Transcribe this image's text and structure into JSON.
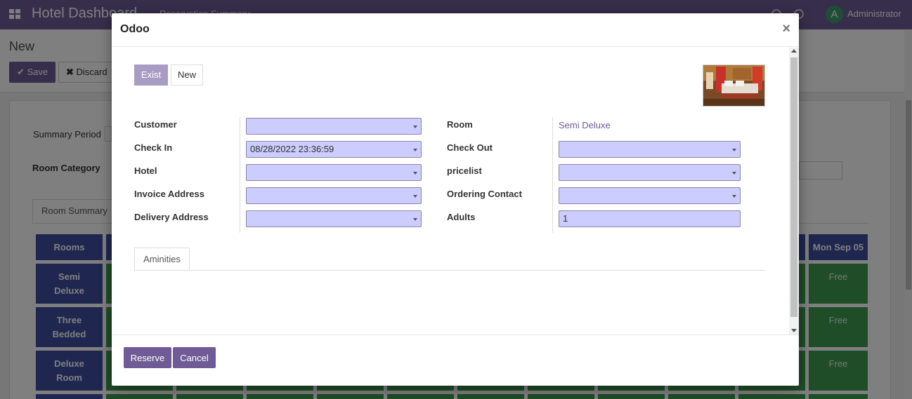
{
  "app": {
    "title": "Hotel Dashboard",
    "menu_item": "Reservation Summary",
    "user_initial": "A",
    "user_name": "Administrator"
  },
  "control_panel": {
    "breadcrumb": "New",
    "save_label": "Save",
    "discard_label": "Discard"
  },
  "form_bg": {
    "summary_period_label": "Summary Period",
    "room_category_label": "Room Category",
    "tab_room_summary": "Room Summary",
    "grid_header_rooms": "Rooms",
    "grid_header_last_day": "Mon Sep 05",
    "rooms": [
      "Semi\nDeluxe",
      "Three\nBedded",
      "Deluxe\nRoom"
    ],
    "status_free": "Free"
  },
  "modal": {
    "title": "Odoo",
    "close_label": "×",
    "toggle_exist": "Exist",
    "toggle_new": "New",
    "fields_left": [
      {
        "label": "Customer",
        "value": ""
      },
      {
        "label": "Check In",
        "value": "08/28/2022 23:36:59"
      },
      {
        "label": "Hotel",
        "value": ""
      },
      {
        "label": "Invoice Address",
        "value": ""
      },
      {
        "label": "Delivery Address",
        "value": ""
      }
    ],
    "fields_right": [
      {
        "label": "Room",
        "value": "Semi Deluxe"
      },
      {
        "label": "Check Out",
        "value": ""
      },
      {
        "label": "pricelist",
        "value": ""
      },
      {
        "label": "Ordering Contact",
        "value": ""
      },
      {
        "label": "Adults",
        "value": "1"
      }
    ],
    "tab_aminities": "Aminities",
    "reserve_label": "Reserve",
    "cancel_label": "Cancel"
  },
  "colors": {
    "brand": "#6f5c97",
    "field_bg": "#ccccff",
    "room_blue": "#3f4ea0",
    "free_green": "#3d9a4e"
  }
}
